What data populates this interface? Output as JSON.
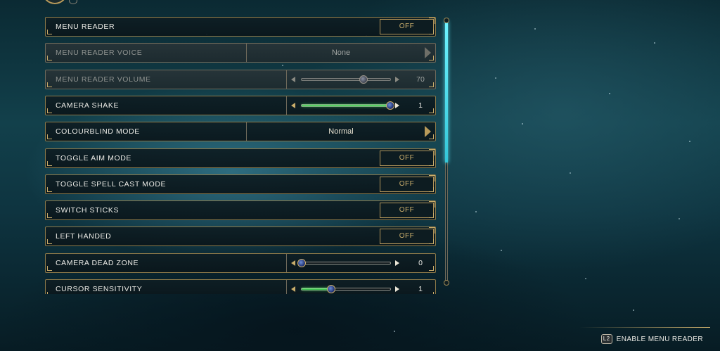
{
  "settings": [
    {
      "label": "MENU READER",
      "kind": "toggle",
      "value": "OFF",
      "disabled": false
    },
    {
      "label": "MENU READER VOICE",
      "kind": "select",
      "value": "None",
      "disabled": true
    },
    {
      "label": "MENU READER VOLUME",
      "kind": "slider",
      "value": "70",
      "level": 0.7,
      "fill": false,
      "disabled": true
    },
    {
      "label": "CAMERA SHAKE",
      "kind": "slider",
      "value": "1",
      "level": 1.0,
      "fill": true,
      "disabled": false
    },
    {
      "label": "COLOURBLIND MODE",
      "kind": "select",
      "value": "Normal",
      "disabled": false
    },
    {
      "label": "TOGGLE AIM MODE",
      "kind": "toggle",
      "value": "OFF",
      "disabled": false
    },
    {
      "label": "TOGGLE SPELL CAST MODE",
      "kind": "toggle",
      "value": "OFF",
      "disabled": false
    },
    {
      "label": "SWITCH STICKS",
      "kind": "toggle",
      "value": "OFF",
      "disabled": false
    },
    {
      "label": "LEFT HANDED",
      "kind": "toggle",
      "value": "OFF",
      "disabled": false
    },
    {
      "label": "CAMERA DEAD ZONE",
      "kind": "slider",
      "value": "0",
      "level": 0.0,
      "fill": false,
      "disabled": false
    },
    {
      "label": "CURSOR SENSITIVITY",
      "kind": "slider",
      "value": "1",
      "level": 0.33,
      "fill": true,
      "disabled": false
    }
  ],
  "footer": {
    "button_glyph": "L2",
    "action_label": "ENABLE MENU READER"
  },
  "scroll": {
    "visible_fraction": 0.54
  },
  "icons": {
    "crest": "house-crest-icon",
    "gear": "gear-icon",
    "left": "arrow-left-icon",
    "right": "arrow-right-icon",
    "next": "chevron-right-icon"
  }
}
